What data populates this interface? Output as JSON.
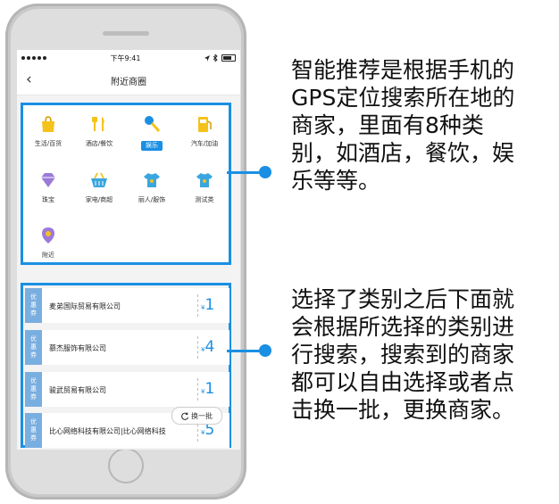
{
  "status_bar": {
    "time": "下午9:41"
  },
  "nav": {
    "back_glyph": "‹",
    "title": "附近商圈"
  },
  "categories": [
    {
      "label": "生活/百货",
      "icon": "shopping-bag-icon",
      "color": "#f5c21b"
    },
    {
      "label": "酒店/餐饮",
      "icon": "fork-knife-icon",
      "color": "#f5c21b"
    },
    {
      "label": "娱乐",
      "icon": "microphone-icon",
      "color": "#1a8fe3",
      "active": true
    },
    {
      "label": "汽车/加油",
      "icon": "gas-pump-icon",
      "color": "#f5c21b"
    },
    {
      "label": "珠宝",
      "icon": "diamond-icon",
      "color": "#9b7ad8"
    },
    {
      "label": "家电/商超",
      "icon": "shopping-basket-icon",
      "color": "#3aa6df"
    },
    {
      "label": "丽人/服饰",
      "icon": "tshirt-icon",
      "color": "#3aa6df"
    },
    {
      "label": "测试类",
      "icon": "tshirt-icon",
      "color": "#3aa6df"
    },
    {
      "label": "附近",
      "icon": "location-pin-icon",
      "color": "#9b7ad8"
    }
  ],
  "coupons": [
    {
      "tag": [
        "优",
        "惠",
        "券"
      ],
      "merchant": "麦弟国际贸易有限公司",
      "currency": "¥",
      "value": "1"
    },
    {
      "tag": [
        "优",
        "惠",
        "券"
      ],
      "merchant": "慕杰服饰有限公司",
      "currency": "¥",
      "value": "4"
    },
    {
      "tag": [
        "优",
        "惠",
        "券"
      ],
      "merchant": "骏武贸易有限公司",
      "currency": "¥",
      "value": "1"
    },
    {
      "tag": [
        "优",
        "惠",
        "券"
      ],
      "merchant": "比心网络科技有限公司|比心网络科技",
      "currency": "¥",
      "value": "5"
    }
  ],
  "swap_button": {
    "icon": "refresh-icon",
    "label": "换一批"
  },
  "annotations": [
    {
      "lines": [
        "智能推荐是根据手机的",
        "GPS定位搜索所在地的",
        "商家，里面有8种类",
        "别，如酒店，餐饮，娱",
        "乐等等。"
      ]
    },
    {
      "lines": [
        "选择了类别之后下面就",
        "会根据所选择的类别进",
        "行搜索，搜索到的商家",
        "都可以自由选择或者点",
        "击换一批，更换商家。"
      ]
    }
  ],
  "colors": {
    "accent": "#1a8fe3",
    "coupon_tag": "#79aee0"
  }
}
